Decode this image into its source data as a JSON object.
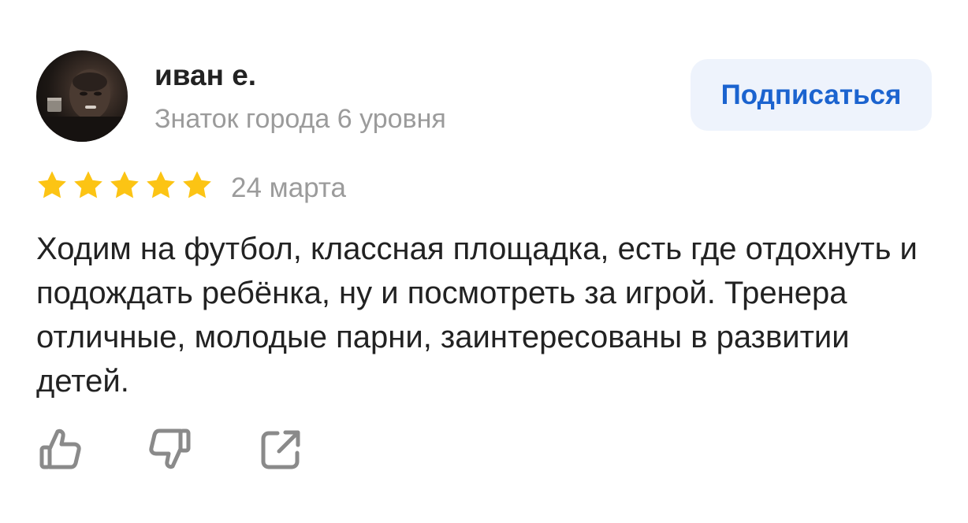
{
  "author": {
    "name": "иван е.",
    "level": "Знаток города 6 уровня",
    "avatar_icon": "user-photo"
  },
  "subscribe": {
    "label": "Подписаться"
  },
  "rating": {
    "stars": 5,
    "max": 5,
    "color": "#fcc414"
  },
  "review": {
    "date": "24 марта",
    "text": "Ходим на футбол, классная площадка, есть где отдохнуть и подождать ребёнка, ну и посмотреть за игрой. Тренера отличные, молодые парни, заинтересованы в развитии детей."
  },
  "actions": [
    {
      "icon": "thumbs-up-icon"
    },
    {
      "icon": "thumbs-down-icon"
    },
    {
      "icon": "share-icon"
    }
  ],
  "colors": {
    "accent": "#1b63cf",
    "button_bg": "#eef3fc",
    "muted_text": "#9b9b9b",
    "icon_gray": "#8a8a8a"
  }
}
